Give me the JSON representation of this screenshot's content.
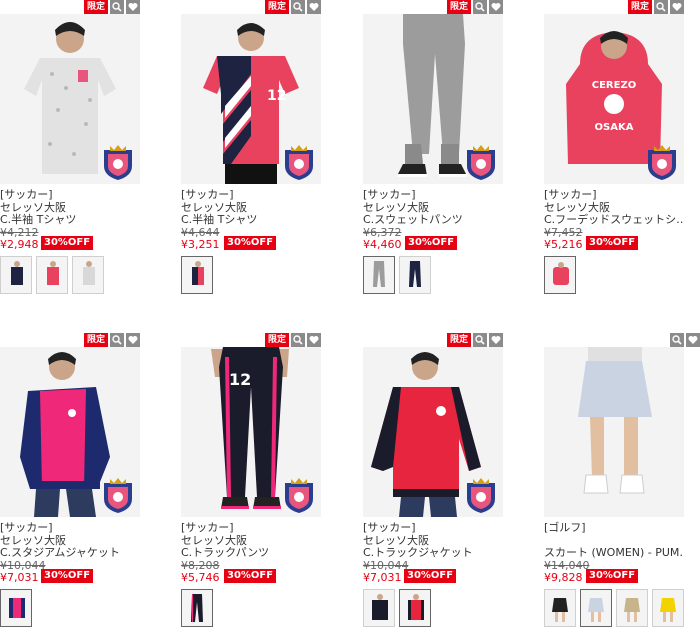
{
  "badge_limited": "限定",
  "colors": {
    "accent": "#e60012",
    "icon_bg": "#8b8b8b"
  },
  "products": [
    {
      "limited": true,
      "category": "[サッカー]",
      "brand": "セレッソ大阪",
      "name": "C.半袖 Tシャツ",
      "price_orig": "¥4,212",
      "price_sale": "¥2,948",
      "discount": "30%OFF",
      "thumbs": 3
    },
    {
      "limited": true,
      "category": "[サッカー]",
      "brand": "セレッソ大阪",
      "name": "C.半袖 Tシャツ",
      "price_orig": "¥4,644",
      "price_sale": "¥3,251",
      "discount": "30%OFF",
      "thumbs": 1
    },
    {
      "limited": true,
      "category": "[サッカー]",
      "brand": "セレッソ大阪",
      "name": "C.スウェットパンツ",
      "price_orig": "¥6,372",
      "price_sale": "¥4,460",
      "discount": "30%OFF",
      "thumbs": 2
    },
    {
      "limited": true,
      "category": "[サッカー]",
      "brand": "セレッソ大阪",
      "name": "C.フーデッドスウェットシ…",
      "price_orig": "¥7,452",
      "price_sale": "¥5,216",
      "discount": "30%OFF",
      "thumbs": 1,
      "print_cerezo": "CEREZO",
      "print_osaka": "OSAKA"
    },
    {
      "limited": true,
      "category": "[サッカー]",
      "brand": "セレッソ大阪",
      "name": "C.スタジアムジャケット",
      "price_orig": "¥10,044",
      "price_sale": "¥7,031",
      "discount": "30%OFF",
      "thumbs": 1
    },
    {
      "limited": true,
      "category": "[サッカー]",
      "brand": "セレッソ大阪",
      "name": "C.トラックパンツ",
      "price_orig": "¥8,208",
      "price_sale": "¥5,746",
      "discount": "30%OFF",
      "thumbs": 1
    },
    {
      "limited": true,
      "category": "[サッカー]",
      "brand": "セレッソ大阪",
      "name": "C.トラックジャケット",
      "price_orig": "¥10,044",
      "price_sale": "¥7,031",
      "discount": "30%OFF",
      "thumbs": 2
    },
    {
      "limited": false,
      "category": "[ゴルフ]",
      "brand": "",
      "name": "スカート (WOMEN) - PUM…",
      "price_orig": "¥14,040",
      "price_sale": "¥9,828",
      "discount": "30%OFF",
      "thumbs": 4
    }
  ],
  "jersey_number": "12"
}
